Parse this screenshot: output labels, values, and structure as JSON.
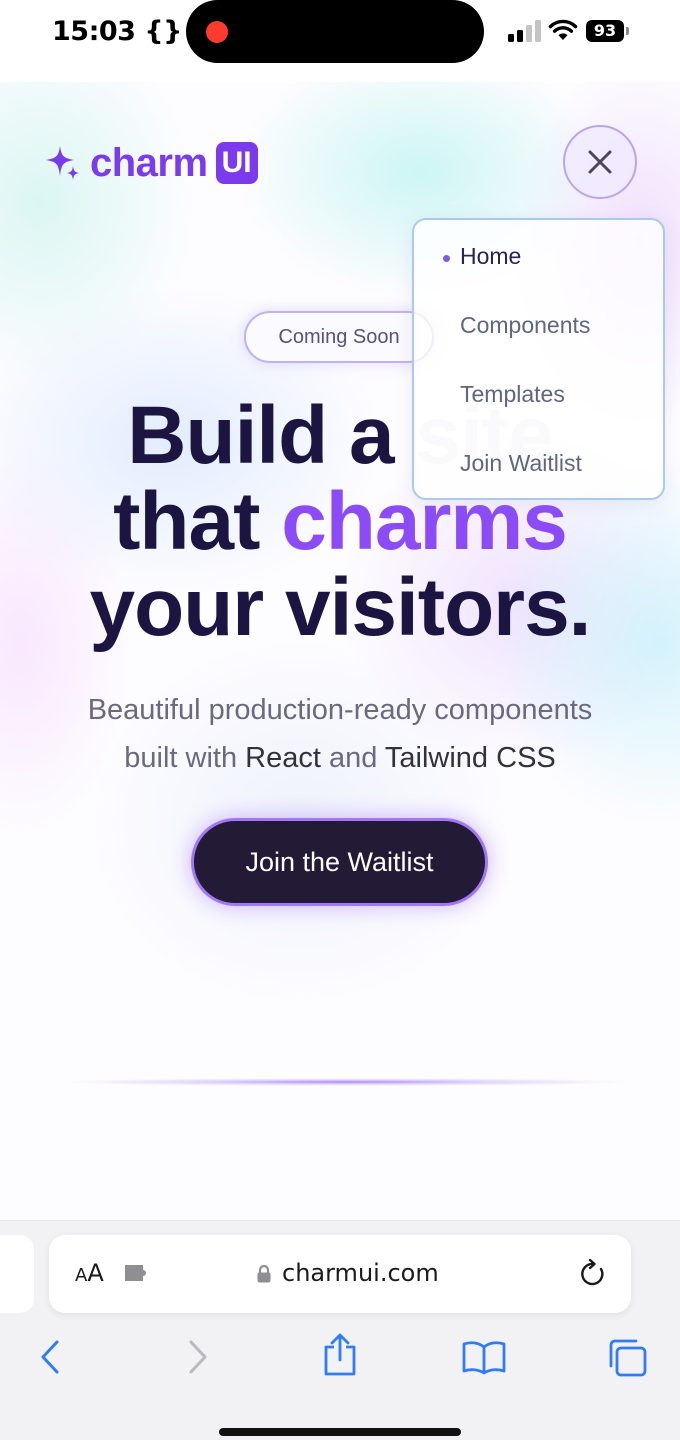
{
  "status": {
    "time": "15:03 {}",
    "battery": "93"
  },
  "logo": {
    "word": "charm",
    "badge": "UI",
    "brand_color": "#7c3aed"
  },
  "nav": {
    "items": [
      {
        "label": "Home",
        "active": true
      },
      {
        "label": "Components",
        "active": false
      },
      {
        "label": "Templates",
        "active": false
      },
      {
        "label": "Join Waitlist",
        "active": false
      }
    ]
  },
  "hero": {
    "badge": "Coming Soon",
    "line1_a": "Build a",
    "line1_b": "site",
    "line2_a": "that",
    "line2_b": "charms",
    "line3": "your visitors.",
    "sub_line1": "Beautiful production-ready components",
    "sub_line2_a": "built with",
    "sub_line2_react": "React",
    "sub_line2_and": "and",
    "sub_line2_tailwind": "Tailwind CSS",
    "cta": "Join the Waitlist",
    "accent_color": "#8b4cf7",
    "cta_color": "#231a36"
  },
  "browser": {
    "aa_small": "A",
    "aa_large": "A",
    "url": "charmui.com"
  },
  "icons": {
    "close": "close-icon",
    "sparkle": "sparkle-icon",
    "lock": "lock-icon",
    "reload": "reload-icon",
    "back": "chevron-left-icon",
    "forward": "chevron-right-icon",
    "share": "share-icon",
    "bookmarks": "book-icon",
    "tabs": "tabs-icon"
  }
}
